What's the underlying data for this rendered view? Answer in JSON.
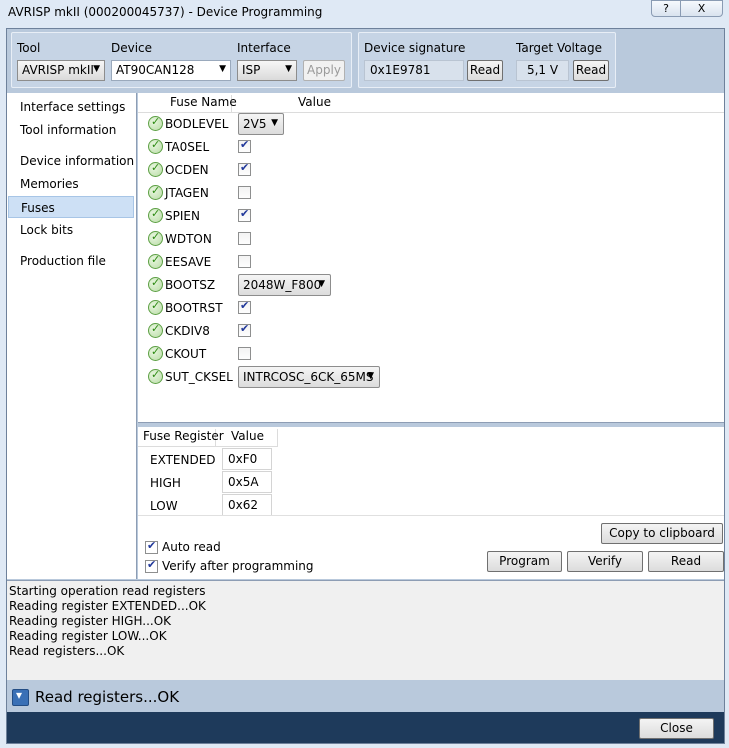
{
  "window": {
    "title": "AVRISP mkII (000200045737) - Device Programming",
    "help_glyph": "?",
    "close_glyph": "X"
  },
  "toolbar": {
    "tool_label": "Tool",
    "tool_value": "AVRISP mkII",
    "device_label": "Device",
    "device_value": "AT90CAN128",
    "interface_label": "Interface",
    "interface_value": "ISP",
    "apply_label": "Apply",
    "signature_label": "Device signature",
    "signature_value": "0x1E9781",
    "signature_read_label": "Read",
    "voltage_label": "Target Voltage",
    "voltage_value": "5,1 V",
    "voltage_read_label": "Read"
  },
  "nav": {
    "items": [
      {
        "label": "Interface settings"
      },
      {
        "label": "Tool information"
      },
      {
        "label": "Device information"
      },
      {
        "label": "Memories"
      },
      {
        "label": "Fuses",
        "selected": true
      },
      {
        "label": "Lock bits"
      },
      {
        "label": "Production file"
      }
    ]
  },
  "fuses": {
    "col_name": "Fuse Name",
    "col_value": "Value",
    "rows": [
      {
        "name": "BODLEVEL",
        "type": "select",
        "value": "2V5"
      },
      {
        "name": "TA0SEL",
        "type": "check",
        "checked": true
      },
      {
        "name": "OCDEN",
        "type": "check",
        "checked": true
      },
      {
        "name": "JTAGEN",
        "type": "check",
        "checked": false
      },
      {
        "name": "SPIEN",
        "type": "check",
        "checked": true
      },
      {
        "name": "WDTON",
        "type": "check",
        "checked": false
      },
      {
        "name": "EESAVE",
        "type": "check",
        "checked": false
      },
      {
        "name": "BOOTSZ",
        "type": "select",
        "value": "2048W_F800"
      },
      {
        "name": "BOOTRST",
        "type": "check",
        "checked": true
      },
      {
        "name": "CKDIV8",
        "type": "check",
        "checked": true
      },
      {
        "name": "CKOUT",
        "type": "check",
        "checked": false
      },
      {
        "name": "SUT_CKSEL",
        "type": "select",
        "value": "INTRCOSC_6CK_65MS"
      }
    ]
  },
  "registers": {
    "col_register": "Fuse Register",
    "col_value": "Value",
    "rows": [
      {
        "name": "EXTENDED",
        "value": "0xF0"
      },
      {
        "name": "HIGH",
        "value": "0x5A"
      },
      {
        "name": "LOW",
        "value": "0x62"
      }
    ]
  },
  "options": {
    "auto_read_label": "Auto read",
    "auto_read_checked": true,
    "verify_label": "Verify after programming",
    "verify_checked": true,
    "copy_label": "Copy to clipboard",
    "program_label": "Program",
    "verify_btn_label": "Verify",
    "read_label": "Read"
  },
  "log": {
    "lines": [
      "Starting operation read registers",
      "Reading register EXTENDED...OK",
      "Reading register HIGH...OK",
      "Reading register LOW...OK",
      "Read registers...OK"
    ]
  },
  "status": {
    "text": "Read registers...OK"
  },
  "footer": {
    "close_label": "Close"
  }
}
